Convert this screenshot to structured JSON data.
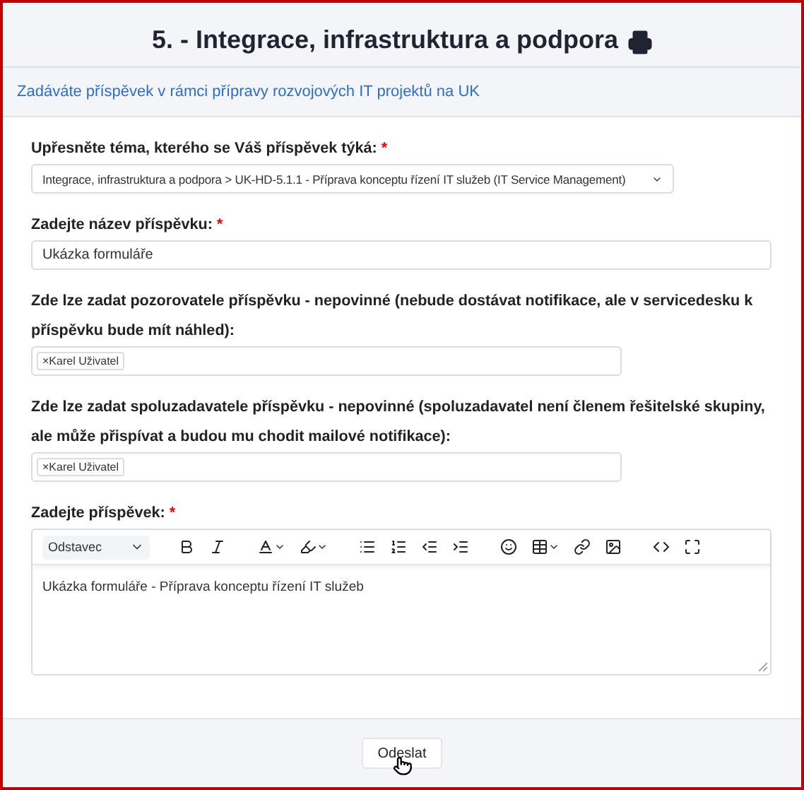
{
  "header": {
    "title": "5. - Integrace, infrastruktura a podpora"
  },
  "notice": "Zadáváte příspěvek v rámci přípravy rozvojových IT projektů na UK",
  "fields": [
    {
      "kind": "select",
      "label": "Upřesněte téma, kterého se Váš příspěvek týká:",
      "required_mark": "*",
      "value": "Integrace, infrastruktura a podpora > UK-HD-5.1.1 - Příprava konceptu řízení IT služeb (IT Service Management)"
    },
    {
      "kind": "text",
      "label": "Zadejte název příspěvku:",
      "required_mark": "*",
      "value": "Ukázka formuláře"
    },
    {
      "kind": "tags",
      "label": "Zde lze zadat pozorovatele příspěvku - nepovinné (nebude dostávat notifikace, ale v servicedesku k příspěvku bude mít náhled):",
      "tags": [
        {
          "remove": "×",
          "label": "Karel Uživatel"
        }
      ]
    },
    {
      "kind": "tags",
      "label": "Zde lze zadat spoluzadavatele příspěvku - nepovinné (spoluzadavatel není členem řešitelské skupiny, ale může přispívat a budou mu chodit mailové notifikace):",
      "tags": [
        {
          "remove": "×",
          "label": "Karel Uživatel"
        }
      ]
    },
    {
      "kind": "editor",
      "label": "Zadejte příspěvek:",
      "required_mark": "*",
      "format": "Odstavec",
      "value": "Ukázka formuláře - Příprava konceptu řízení IT služeb"
    }
  ],
  "submit": "Odeslat"
}
